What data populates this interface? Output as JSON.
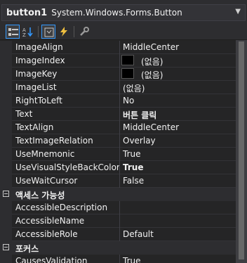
{
  "object_selector": {
    "name": "button1",
    "type": "System.Windows.Forms.Button"
  },
  "toolbar": {
    "buttons": [
      {
        "icon": "categorized-icon",
        "active": true
      },
      {
        "icon": "alphabetical-icon",
        "active": false
      },
      {
        "icon": "properties-icon",
        "active": true
      },
      {
        "icon": "events-icon",
        "active": false
      },
      {
        "icon": "property-pages-icon",
        "active": false
      }
    ]
  },
  "rows": [
    {
      "kind": "prop",
      "name": "ImageAlign",
      "value": "MiddleCenter"
    },
    {
      "kind": "prop",
      "name": "ImageIndex",
      "value": "(없음)",
      "swatch": true
    },
    {
      "kind": "prop",
      "name": "ImageKey",
      "value": "(없음)",
      "swatch": true
    },
    {
      "kind": "prop",
      "name": "ImageList",
      "value": "(없음)"
    },
    {
      "kind": "prop",
      "name": "RightToLeft",
      "value": "No"
    },
    {
      "kind": "prop",
      "name": "Text",
      "value": "버튼 클릭",
      "bold": true
    },
    {
      "kind": "prop",
      "name": "TextAlign",
      "value": "MiddleCenter"
    },
    {
      "kind": "prop",
      "name": "TextImageRelation",
      "value": "Overlay"
    },
    {
      "kind": "prop",
      "name": "UseMnemonic",
      "value": "True"
    },
    {
      "kind": "prop",
      "name": "UseVisualStyleBackColor",
      "value": "True",
      "bold": true
    },
    {
      "kind": "prop",
      "name": "UseWaitCursor",
      "value": "False"
    },
    {
      "kind": "category",
      "name": "액세스 가능성"
    },
    {
      "kind": "prop",
      "name": "AccessibleDescription",
      "value": ""
    },
    {
      "kind": "prop",
      "name": "AccessibleName",
      "value": ""
    },
    {
      "kind": "prop",
      "name": "AccessibleRole",
      "value": "Default"
    },
    {
      "kind": "category",
      "name": "포커스"
    },
    {
      "kind": "prop",
      "name": "CausesValidation",
      "value": "True"
    }
  ]
}
